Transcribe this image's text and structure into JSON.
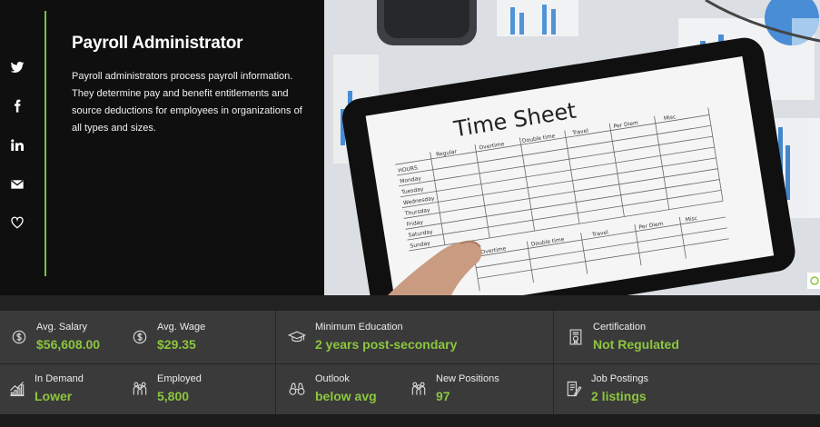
{
  "social": {
    "items": [
      {
        "name": "twitter",
        "icon": "twitter-icon"
      },
      {
        "name": "facebook",
        "icon": "facebook-icon"
      },
      {
        "name": "linkedin",
        "icon": "linkedin-icon"
      },
      {
        "name": "email",
        "icon": "email-icon"
      },
      {
        "name": "favorite",
        "icon": "heart-icon"
      }
    ]
  },
  "hero": {
    "title": "Payroll Administrator",
    "description": "Payroll administrators process payroll information. They determine pay and benefit entitlements and source deductions for employees in organizations of all types and sizes.",
    "image": {
      "sheet_title": "Time Sheet",
      "columns_top": [
        "Regular",
        "Overtime",
        "Double time",
        "Travel",
        "Per Diem",
        "Misc"
      ],
      "rows": [
        "HOURS",
        "Monday",
        "Tuesday",
        "Wednesday",
        "Thursday",
        "Friday",
        "Saturday",
        "Sunday"
      ],
      "columns_bottom": [
        "Overtime",
        "Double time",
        "Travel",
        "Per Diem",
        "Misc"
      ]
    }
  },
  "stats": {
    "avg_salary": {
      "label": "Avg. Salary",
      "value": "$56,608.00",
      "icon": "dollar-circle-icon"
    },
    "avg_wage": {
      "label": "Avg. Wage",
      "value": "$29.35",
      "icon": "dollar-circle-icon"
    },
    "min_education": {
      "label": "Minimum Education",
      "value": "2 years post-secondary",
      "icon": "graduation-cap-icon"
    },
    "certification": {
      "label": "Certification",
      "value": "Not Regulated",
      "icon": "certificate-icon"
    },
    "in_demand": {
      "label": "In Demand",
      "value": "Lower",
      "icon": "bar-chart-icon"
    },
    "employed": {
      "label": "Employed",
      "value": "5,800",
      "icon": "people-icon"
    },
    "outlook": {
      "label": "Outlook",
      "value": "below avg",
      "icon": "binoculars-icon"
    },
    "new_positions": {
      "label": "New Positions",
      "value": "97",
      "icon": "people-icon"
    },
    "job_postings": {
      "label": "Job Postings",
      "value": "2 listings",
      "icon": "document-pen-icon"
    }
  },
  "colors": {
    "accent": "#8cc63f",
    "accent_line": "#7dc143",
    "background": "#0f0f0f",
    "stats_background": "#3a3a3a"
  }
}
